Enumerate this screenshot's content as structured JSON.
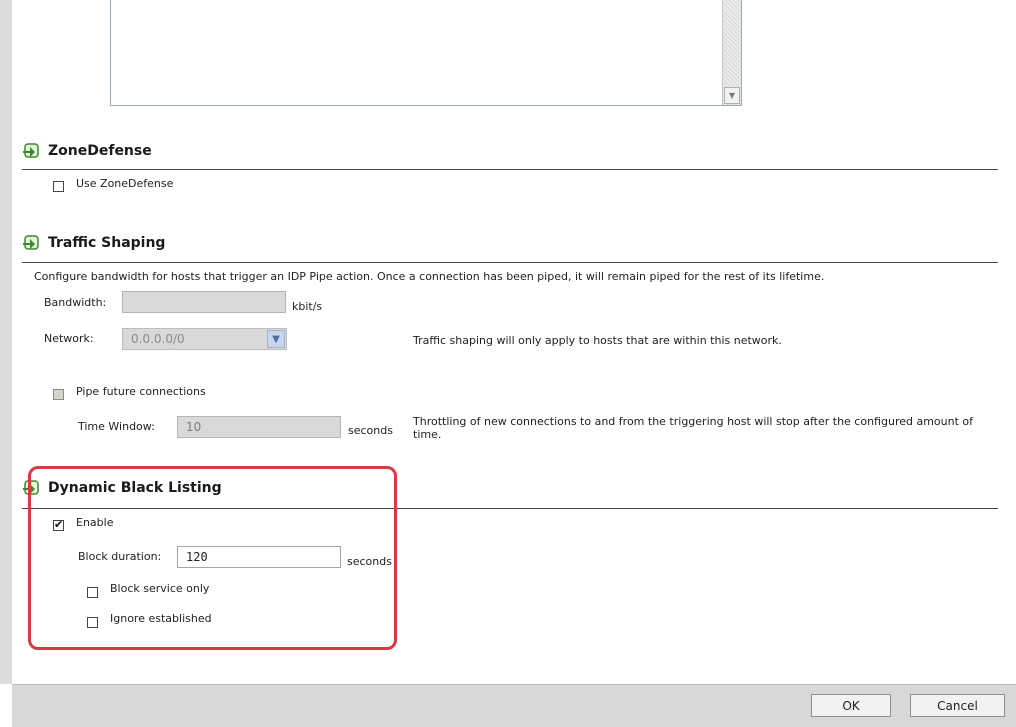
{
  "zone_defense": {
    "title": "ZoneDefense",
    "use_label": "Use ZoneDefense"
  },
  "traffic_shaping": {
    "title": "Traffic Shaping",
    "description": "Configure bandwidth for hosts that trigger an IDP Pipe action. Once a connection has been piped, it will remain piped for the rest of its lifetime.",
    "bandwidth_label": "Bandwidth:",
    "bandwidth_value": "",
    "bandwidth_unit": "kbit/s",
    "network_label": "Network:",
    "network_value": "0.0.0.0/0",
    "network_help": "Traffic shaping will only apply to hosts that are within this network.",
    "pipe_future_label": "Pipe future connections",
    "time_window_label": "Time Window:",
    "time_window_value": "10",
    "time_window_unit": "seconds",
    "time_window_help": "Throttling of new connections to and from the triggering host will stop after the configured amount of time."
  },
  "dynamic_black_listing": {
    "title": "Dynamic Black Listing",
    "enable_label": "Enable",
    "enable_checked": true,
    "block_duration_label": "Block duration:",
    "block_duration_value": "120",
    "block_duration_unit": "seconds",
    "block_service_only_label": "Block service only",
    "ignore_established_label": "Ignore established"
  },
  "footer": {
    "ok_label": "OK",
    "cancel_label": "Cancel"
  },
  "colors": {
    "highlight": "#d73a42",
    "section_icon": "#3a8a2e"
  }
}
